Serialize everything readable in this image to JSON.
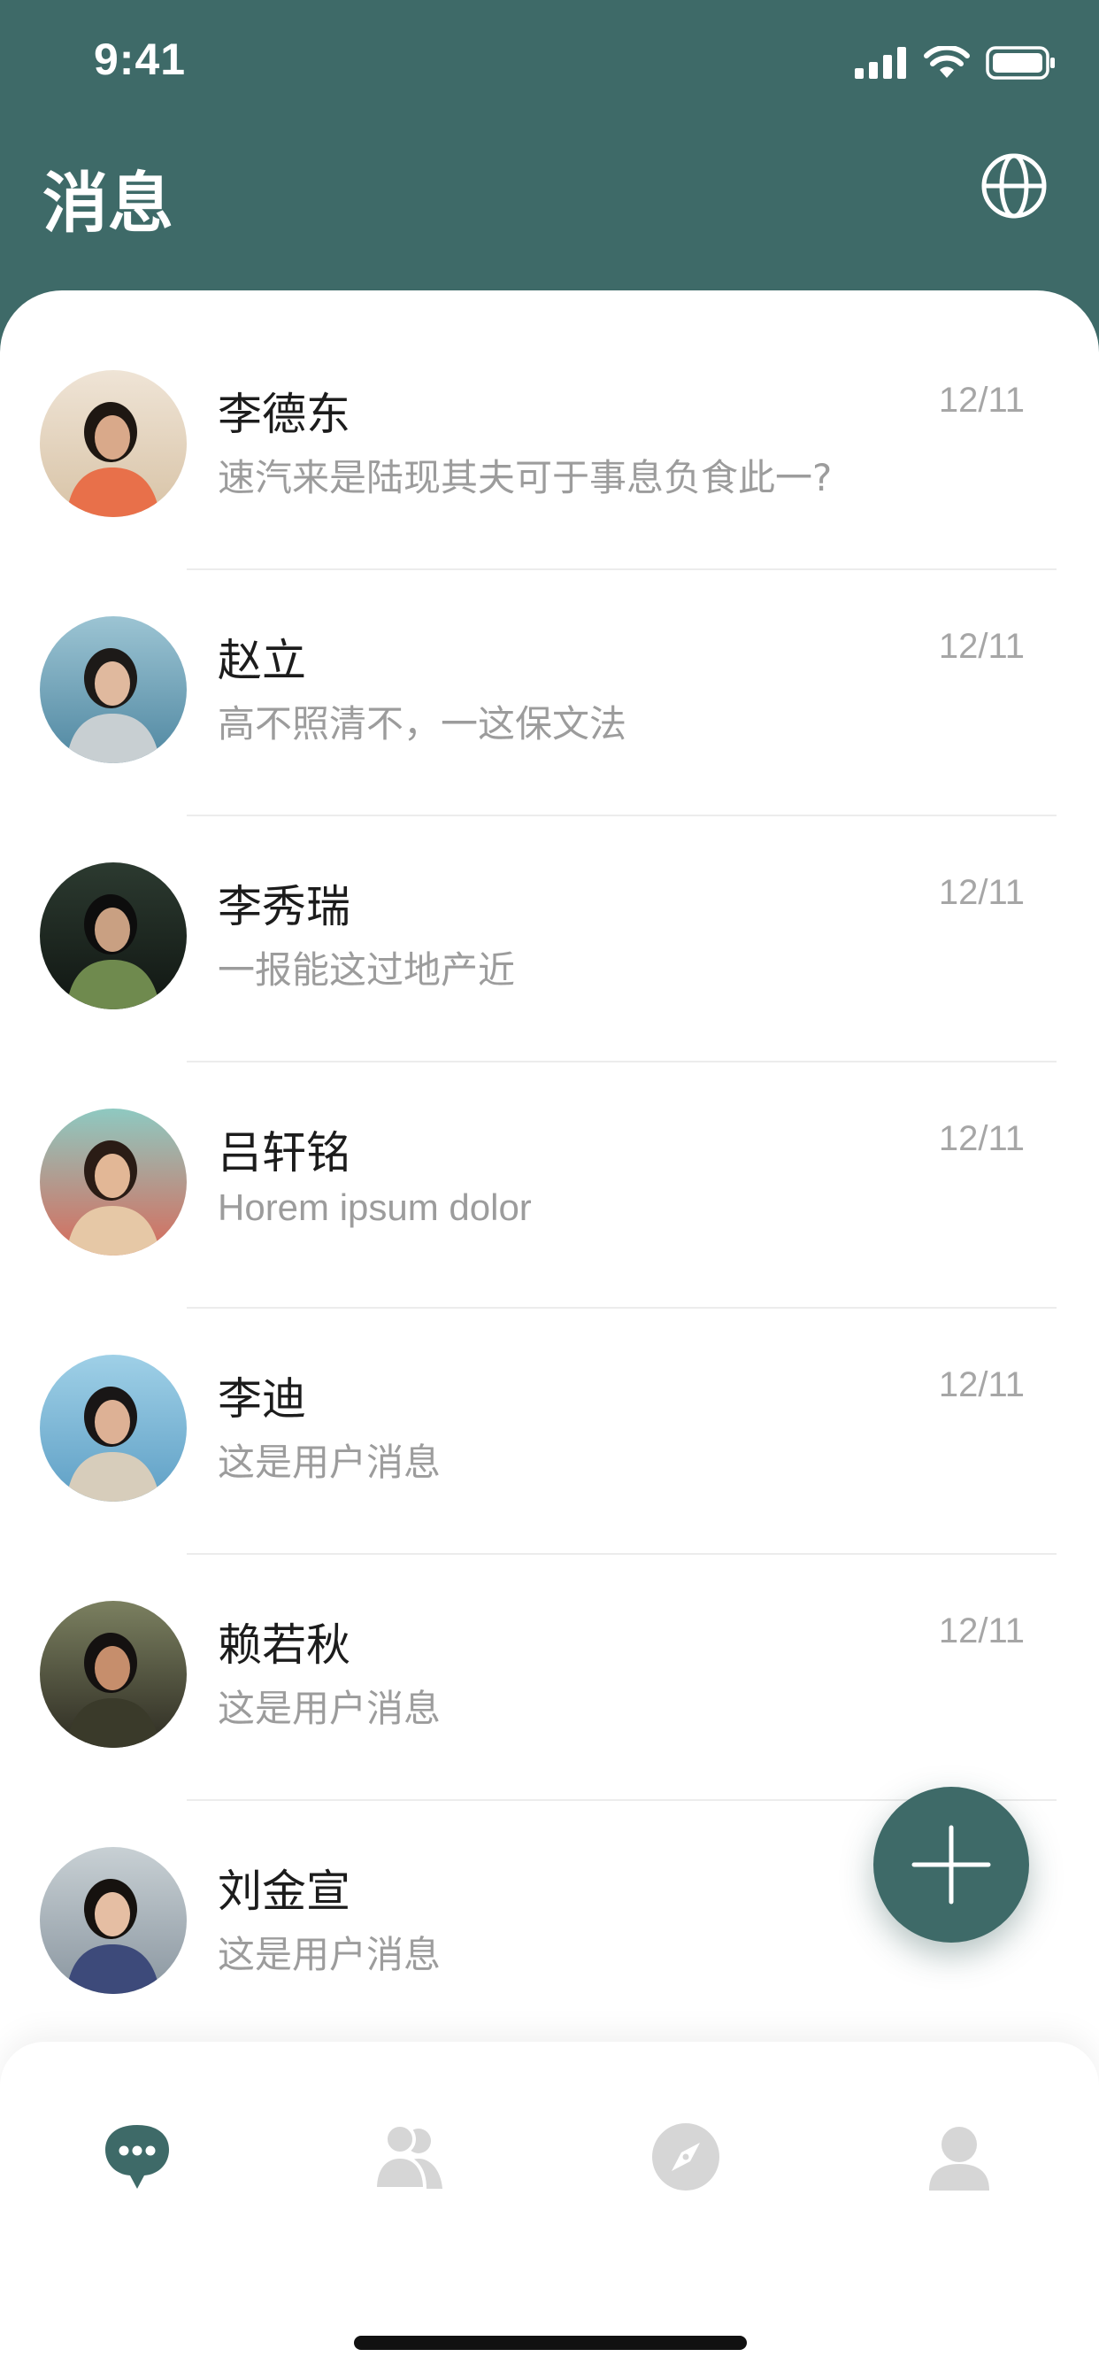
{
  "status_bar": {
    "time": "9:41"
  },
  "header": {
    "title": "消息"
  },
  "conversations": [
    {
      "name": "李德东",
      "message": "速汽来是陆现其夫可于事息负食此一?",
      "date": "12/11"
    },
    {
      "name": "赵立",
      "message": "高不照清不，一这保文法",
      "date": "12/11"
    },
    {
      "name": "李秀瑞",
      "message": "一报能这过地产近",
      "date": "12/11"
    },
    {
      "name": "吕轩铭",
      "message": "Horem ipsum dolor",
      "date": "12/11"
    },
    {
      "name": "李迪",
      "message": "这是用户消息",
      "date": "12/11"
    },
    {
      "name": "赖若秋",
      "message": "这是用户消息",
      "date": "12/11"
    },
    {
      "name": "刘金宣",
      "message": "这是用户消息",
      "date": ""
    }
  ],
  "fab": {
    "icon": "plus-icon"
  },
  "tab_bar": {
    "tabs": [
      {
        "icon": "chat-bubble-icon",
        "active": true
      },
      {
        "icon": "contacts-icon",
        "active": false
      },
      {
        "icon": "compass-icon",
        "active": false
      },
      {
        "icon": "profile-icon",
        "active": false
      }
    ]
  },
  "colors": {
    "brand": "#3e6a68",
    "text_primary": "#1c1c1c",
    "text_secondary": "#9c9c9c",
    "tab_inactive": "#d6d6d6"
  }
}
